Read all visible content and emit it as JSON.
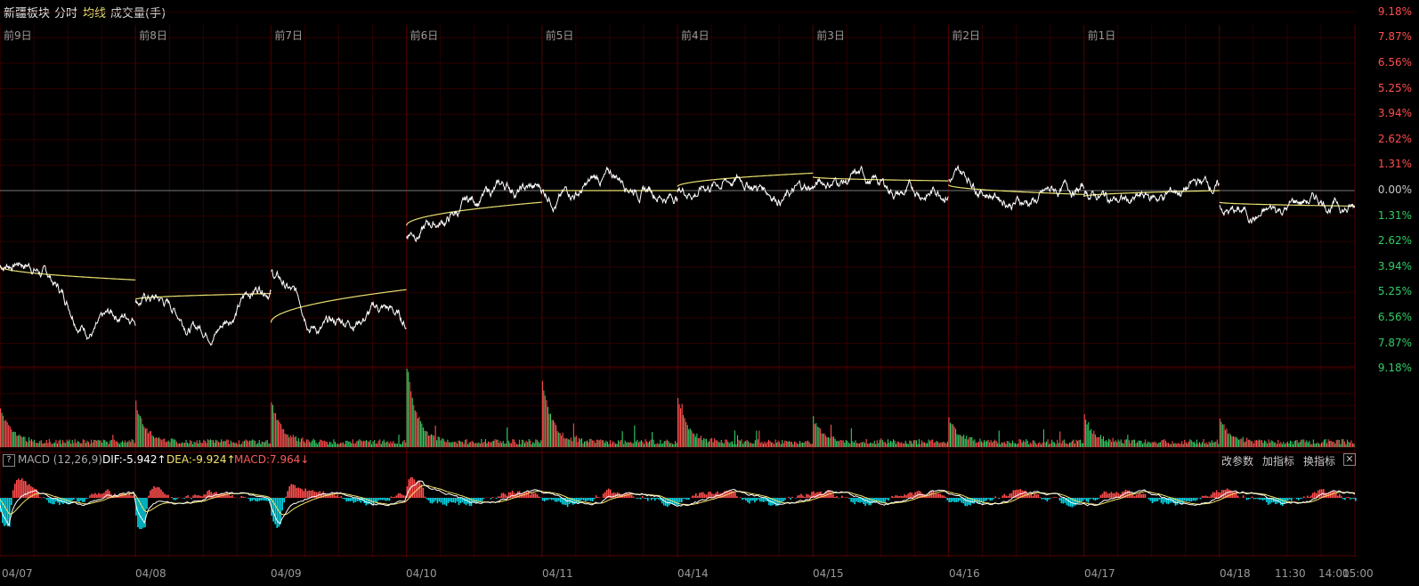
{
  "toolbar": {
    "sector": "新疆板块",
    "intraday": "分时",
    "avg_line": "均线",
    "volume": "成交量(手)"
  },
  "day_labels": [
    "前9日",
    "前8日",
    "前7日",
    "前6日",
    "前5日",
    "前4日",
    "前3日",
    "前2日",
    "前1日"
  ],
  "date_labels": [
    "04/07",
    "04/08",
    "04/09",
    "04/10",
    "04/11",
    "04/14",
    "04/15",
    "04/16",
    "04/17",
    "04/18",
    "11:30",
    "14:00",
    "15:00"
  ],
  "pct_axis": {
    "up": [
      "9.18%",
      "7.87%",
      "6.56%",
      "5.25%",
      "3.94%",
      "2.62%",
      "1.31%"
    ],
    "zero": "0.00%",
    "down": [
      "1.31%",
      "2.62%",
      "3.94%",
      "5.25%",
      "6.56%",
      "7.87%",
      "9.18%"
    ]
  },
  "macd": {
    "title": "MACD (12,26,9)",
    "dif": "DIF:-5.942",
    "dea": "DEA:-9.924",
    "macd": "MACD:7.964",
    "dif_arrow": "↑",
    "dea_arrow": "↑",
    "macd_arrow": "↓",
    "help_label": "?",
    "buttons": [
      "改参数",
      "加指标",
      "换指标"
    ],
    "close_label": "✕"
  },
  "colors": {
    "up": "#ff4d4d",
    "down": "#33cc66",
    "price_line": "#ffffff",
    "avg_line": "#e8e070",
    "macd_neg": "#00d8e8",
    "grid": "#2e0000",
    "dif": "#ffffff",
    "dea": "#f5e46c"
  },
  "chart_data": {
    "type": "line",
    "days": [
      "04/07",
      "04/08",
      "04/09",
      "04/10",
      "04/11",
      "04/14",
      "04/15",
      "04/16",
      "04/17",
      "04/18"
    ],
    "yrange_pct": [
      -9.18,
      9.18
    ],
    "series": [
      {
        "values_pct_open_close": [
          [
            -3.9,
            -6.8
          ],
          [
            -6.6,
            -5.5
          ],
          [
            -5.1,
            -7.4
          ],
          [
            -2.5,
            0.1
          ],
          [
            0.2,
            0.3
          ],
          [
            0.3,
            0.3
          ],
          [
            0.3,
            0.2
          ],
          [
            0.3,
            -0.3
          ],
          [
            -0.5,
            0.0
          ],
          [
            -1.0,
            -0.8
          ]
        ]
      },
      {
        "values_pct_open_close": [
          [
            -3.9,
            -4.6
          ],
          [
            -5.6,
            -5.3
          ],
          [
            -6.8,
            -5.1
          ],
          [
            -1.8,
            -0.6
          ],
          [
            0.0,
            0.0
          ],
          [
            0.2,
            0.9
          ],
          [
            0.7,
            0.5
          ],
          [
            0.3,
            -0.2
          ],
          [
            -0.3,
            0.0
          ],
          [
            -0.6,
            -0.8
          ]
        ]
      }
    ]
  }
}
